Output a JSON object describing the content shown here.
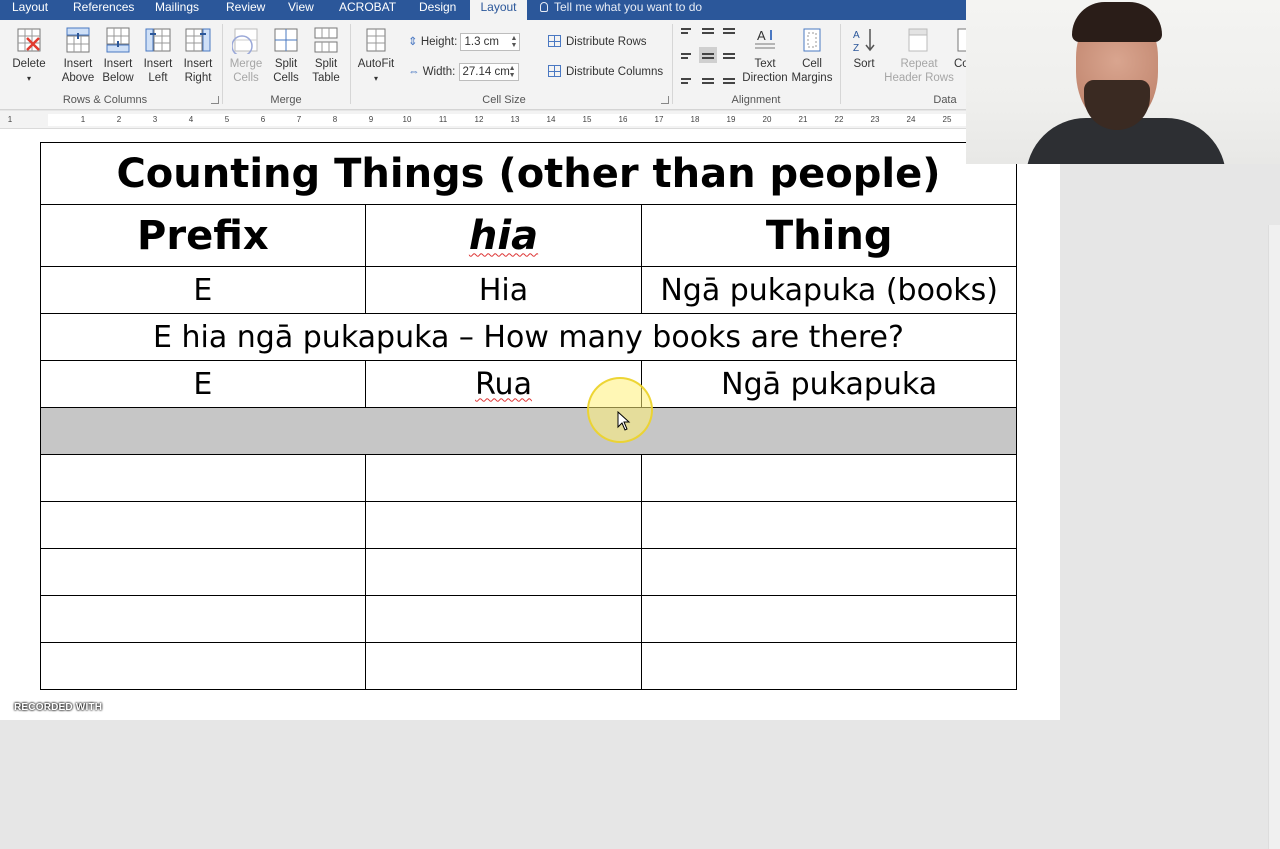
{
  "tabs": [
    {
      "label": "Layout"
    },
    {
      "label": "References"
    },
    {
      "label": "Mailings"
    },
    {
      "label": "Review"
    },
    {
      "label": "View"
    },
    {
      "label": "ACROBAT"
    },
    {
      "label": "Design"
    },
    {
      "label": "Layout"
    }
  ],
  "tell_me": "Tell me what you want to do",
  "ribbon": {
    "delete": "Delete",
    "insert_above": "Insert Above",
    "insert_below": "Insert Below",
    "insert_left": "Insert Left",
    "insert_right": "Insert Right",
    "rows_columns": "Rows & Columns",
    "merge_cells": "Merge Cells",
    "split_cells": "Split Cells",
    "split_table": "Split Table",
    "merge": "Merge",
    "autofit": "AutoFit",
    "height_label": "Height:",
    "height_value": "1.3 cm",
    "width_label": "Width:",
    "width_value": "27.14 cm",
    "distribute_rows": "Distribute Rows",
    "distribute_columns": "Distribute Columns",
    "cell_size": "Cell Size",
    "text_direction": "Text Direction",
    "cell_margins": "Cell Margins",
    "alignment": "Alignment",
    "sort": "Sort",
    "repeat_header_rows": "Repeat Header Rows",
    "convert_partial": "Co",
    "data": "Data"
  },
  "ruler_ticks": [
    "1",
    "1",
    "2",
    "3",
    "4",
    "5",
    "6",
    "7",
    "8",
    "9",
    "10",
    "11",
    "12",
    "13",
    "14",
    "15",
    "16",
    "17",
    "18",
    "19",
    "20",
    "21",
    "22",
    "23",
    "24",
    "25"
  ],
  "table": {
    "title": "Counting Things (other than people)",
    "headers": [
      "Prefix",
      "hia",
      "Thing"
    ],
    "row1": [
      "E",
      "Hia",
      "Ngā pukapuka (books)"
    ],
    "sentence": "E hia ngā pukapuka – How many books are there?",
    "row2": [
      "E",
      "Rua",
      "Ngā pukapuka"
    ]
  },
  "watermark": "RECORDED WITH"
}
